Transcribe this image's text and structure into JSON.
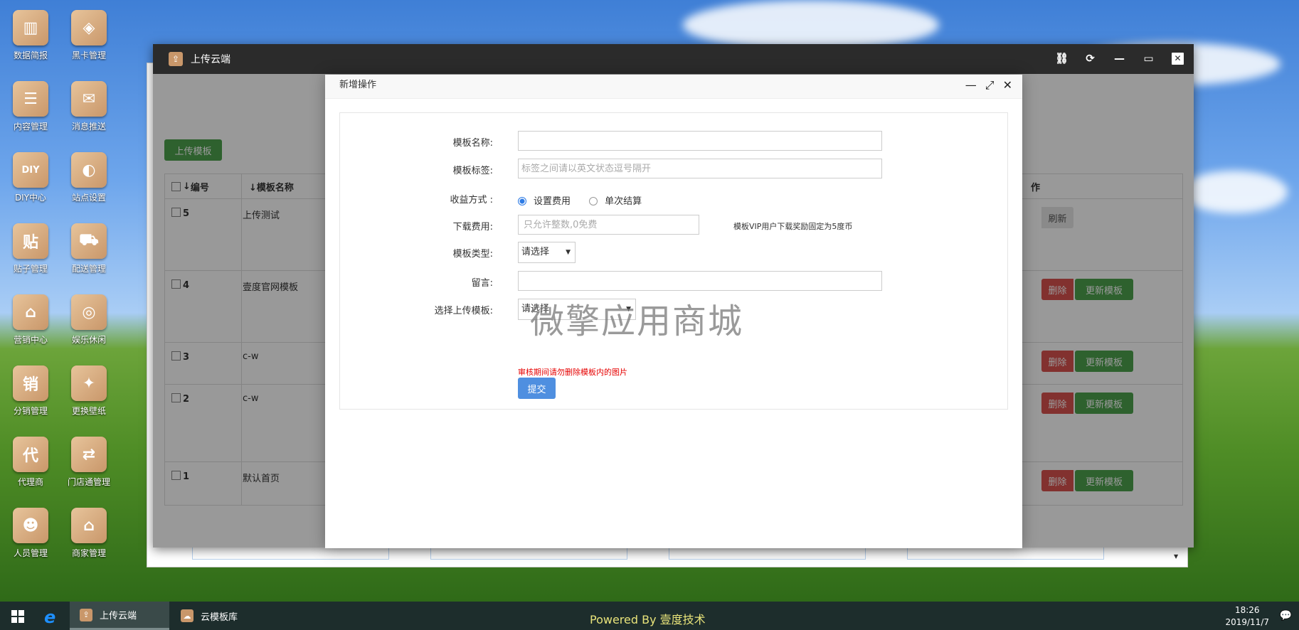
{
  "desktop": {
    "icons": [
      {
        "label": "数据简报",
        "glyph": "▥"
      },
      {
        "label": "黑卡管理",
        "glyph": "◈"
      },
      {
        "label": "内容管理",
        "glyph": "☰"
      },
      {
        "label": "消息推送",
        "glyph": "✉"
      },
      {
        "label": "DIY中心",
        "glyph": "DIY"
      },
      {
        "label": "站点设置",
        "glyph": "◐"
      },
      {
        "label": "贴子管理",
        "glyph": "贴"
      },
      {
        "label": "配送管理",
        "glyph": "⛟"
      },
      {
        "label": "营销中心",
        "glyph": "⌂"
      },
      {
        "label": "娱乐休闲",
        "glyph": "◎"
      },
      {
        "label": "分销管理",
        "glyph": "销"
      },
      {
        "label": "更换壁纸",
        "glyph": "✦"
      },
      {
        "label": "代理商",
        "glyph": "代"
      },
      {
        "label": "门店通管理",
        "glyph": "⇄"
      },
      {
        "label": "人员管理",
        "glyph": "☻"
      },
      {
        "label": "商家管理",
        "glyph": "⌂"
      }
    ]
  },
  "window": {
    "title": "上传云端",
    "controls": {
      "link": "⛓",
      "refresh": "⟳",
      "minimize": "—",
      "maximize": "▭",
      "close": "✕"
    }
  },
  "page": {
    "upload_button": "上传模板",
    "table": {
      "col_id": "编号",
      "col_name": "模板名称",
      "col_ops": "作",
      "rows": [
        {
          "id": "5",
          "name": "上传测试"
        },
        {
          "id": "4",
          "name": "壹度官网模板"
        },
        {
          "id": "3",
          "name": "c-w"
        },
        {
          "id": "2",
          "name": "c-w"
        },
        {
          "id": "1",
          "name": "默认首页"
        }
      ],
      "refresh_label": "刷新",
      "delete_label": "删除",
      "update_label": "更新模板"
    }
  },
  "modal": {
    "title": "新增操作",
    "controls": {
      "minimize": "—",
      "maximize": "⤢",
      "close": "✕"
    },
    "fields": {
      "name_label": "模板名称:",
      "name_value": "",
      "tags_label": "模板标签:",
      "tags_placeholder": "标签之间请以英文状态逗号隔开",
      "income_label": "收益方式 :",
      "income_option1": "设置费用",
      "income_option2": "单次结算",
      "fee_label": "下载费用:",
      "fee_placeholder": "只允许整数,0免费",
      "fee_hint": "模板VIP用户下载奖励固定为5度币",
      "type_label": "模板类型:",
      "type_value": "请选择",
      "message_label": "留言:",
      "message_value": "",
      "upload_label": "选择上传模板:",
      "upload_value": "请选择",
      "warning": "审核期间请勿删除模板内的图片",
      "submit": "提交"
    },
    "watermark": "微擎应用商城"
  },
  "taskbar": {
    "tasks": [
      {
        "label": "上传云端",
        "active": true
      },
      {
        "label": "云模板库",
        "active": false
      }
    ],
    "powered": "Powered By 壹度技术",
    "time": "18:26",
    "date": "2019/11/7",
    "notification_glyph": "💬"
  },
  "colors": {
    "green": "#4ea24e",
    "red": "#d9534f",
    "blue": "#4f8fe0",
    "warning": "#e60000"
  }
}
